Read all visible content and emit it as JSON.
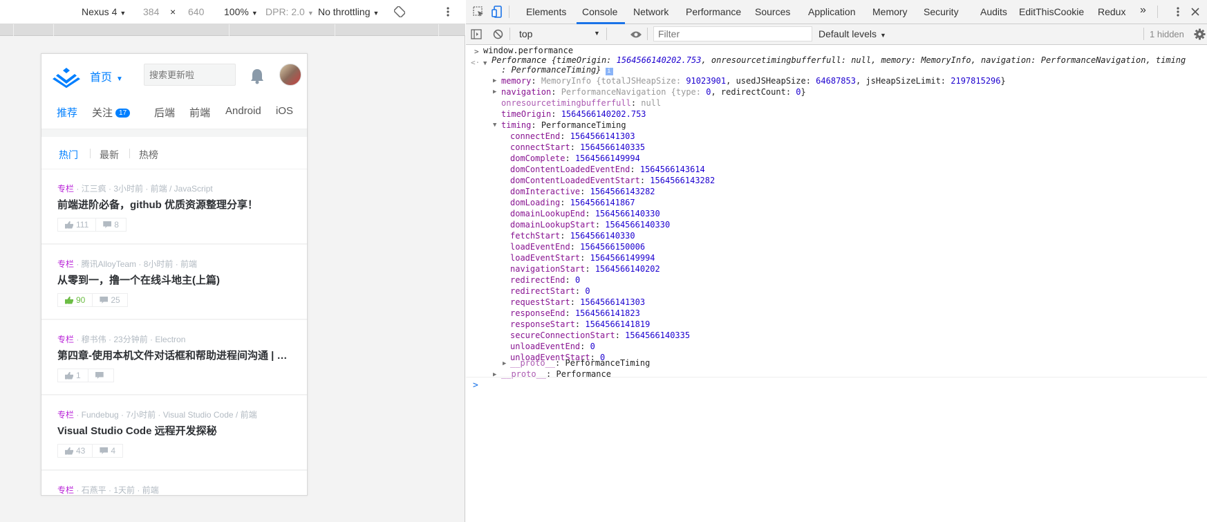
{
  "device_toolbar": {
    "device": "Nexus 4",
    "width": "384",
    "times": "×",
    "height": "640",
    "zoom": "100%",
    "dpr": "DPR: 2.0",
    "throttle": "No throttling"
  },
  "page": {
    "home_label": "首页",
    "search_placeholder": "搜索更新啦",
    "nav_tabs": [
      "推荐",
      "关注",
      "后端",
      "前端",
      "Android",
      "iOS"
    ],
    "follow_badge": "17",
    "sub_tabs": [
      "热门",
      "最新",
      "热榜"
    ],
    "articles": [
      {
        "tag": "专栏",
        "meta": " · 江三疯 · 3小时前 · 前端 / JavaScript",
        "title": "前端进阶必备，github 优质资源整理分享！",
        "likes": "111",
        "comments": "8",
        "liked": false
      },
      {
        "tag": "专栏",
        "meta": " · 腾讯AlloyTeam · 8小时前 · 前端",
        "title": "从零到一，撸一个在线斗地主(上篇)",
        "likes": "90",
        "comments": "25",
        "liked": true
      },
      {
        "tag": "专栏",
        "meta": " · 穆书伟 · 23分钟前 · Electron",
        "title": "第四章-使用本机文件对话框和帮助进程间沟通 | Electron",
        "likes": "1",
        "comments": "",
        "liked": false
      },
      {
        "tag": "专栏",
        "meta": " · Fundebug · 7小时前 · Visual Studio Code / 前端",
        "title": "Visual Studio Code 远程开发探秘",
        "likes": "43",
        "comments": "4",
        "liked": false
      },
      {
        "tag": "专栏",
        "meta": " · 石燕平 · 1天前 · 前端",
        "title": "",
        "likes": "",
        "comments": "",
        "liked": false
      }
    ]
  },
  "devtools": {
    "tabs": [
      "Elements",
      "Console",
      "Network",
      "Performance",
      "Sources",
      "Application",
      "Memory",
      "Security",
      "Audits",
      "EditThisCookie",
      "Redux"
    ],
    "more": "»",
    "context": "top",
    "filter_placeholder": "Filter",
    "levels": "Default levels",
    "hidden": "1 hidden"
  },
  "console": {
    "input": "window.performance",
    "summary_a": "Performance {timeOrigin: ",
    "summary_origin": "1564566140202.753",
    "summary_b": ", onresourcetimingbufferfull: null, memory: MemoryInfo, navigation: PerformanceNavigation, timing",
    "summary_c": ": PerformanceTiming}",
    "memory_key": "memory",
    "memory_val_a": "MemoryInfo {totalJSHeapSize: ",
    "memory_total": "91023901",
    "memory_val_b": ", usedJSHeapSize: ",
    "memory_used": "64687853",
    "memory_val_c": ", jsHeapSizeLimit: ",
    "memory_limit": "2197815296",
    "memory_val_d": "}",
    "navigation_key": "navigation",
    "navigation_val_a": "PerformanceNavigation {type: ",
    "navigation_type": "0",
    "navigation_val_b": ", redirectCount: ",
    "navigation_count": "0",
    "navigation_val_c": "}",
    "onres_key": "onresourcetimingbufferfull",
    "onres_val": "null",
    "origin_key": "timeOrigin",
    "origin_val": "1564566140202.753",
    "timing_key": "timing",
    "timing_val": "PerformanceTiming",
    "timing_entries": [
      {
        "k": "connectEnd",
        "v": "1564566141303"
      },
      {
        "k": "connectStart",
        "v": "1564566140335"
      },
      {
        "k": "domComplete",
        "v": "1564566149994"
      },
      {
        "k": "domContentLoadedEventEnd",
        "v": "1564566143614"
      },
      {
        "k": "domContentLoadedEventStart",
        "v": "1564566143282"
      },
      {
        "k": "domInteractive",
        "v": "1564566143282"
      },
      {
        "k": "domLoading",
        "v": "1564566141867"
      },
      {
        "k": "domainLookupEnd",
        "v": "1564566140330"
      },
      {
        "k": "domainLookupStart",
        "v": "1564566140330"
      },
      {
        "k": "fetchStart",
        "v": "1564566140330"
      },
      {
        "k": "loadEventEnd",
        "v": "1564566150006"
      },
      {
        "k": "loadEventStart",
        "v": "1564566149994"
      },
      {
        "k": "navigationStart",
        "v": "1564566140202"
      },
      {
        "k": "redirectEnd",
        "v": "0"
      },
      {
        "k": "redirectStart",
        "v": "0"
      },
      {
        "k": "requestStart",
        "v": "1564566141303"
      },
      {
        "k": "responseEnd",
        "v": "1564566141823"
      },
      {
        "k": "responseStart",
        "v": "1564566141819"
      },
      {
        "k": "secureConnectionStart",
        "v": "1564566140335"
      },
      {
        "k": "unloadEventEnd",
        "v": "0"
      },
      {
        "k": "unloadEventStart",
        "v": "0"
      }
    ],
    "proto_key": "__proto__",
    "proto_timing": "PerformanceTiming",
    "proto_perf": "Performance"
  },
  "colors": {
    "accent": "#007fff",
    "tag": "#b71ed7",
    "prop": "#881391",
    "number": "#1c00cf",
    "liked": "#6cbd45"
  }
}
